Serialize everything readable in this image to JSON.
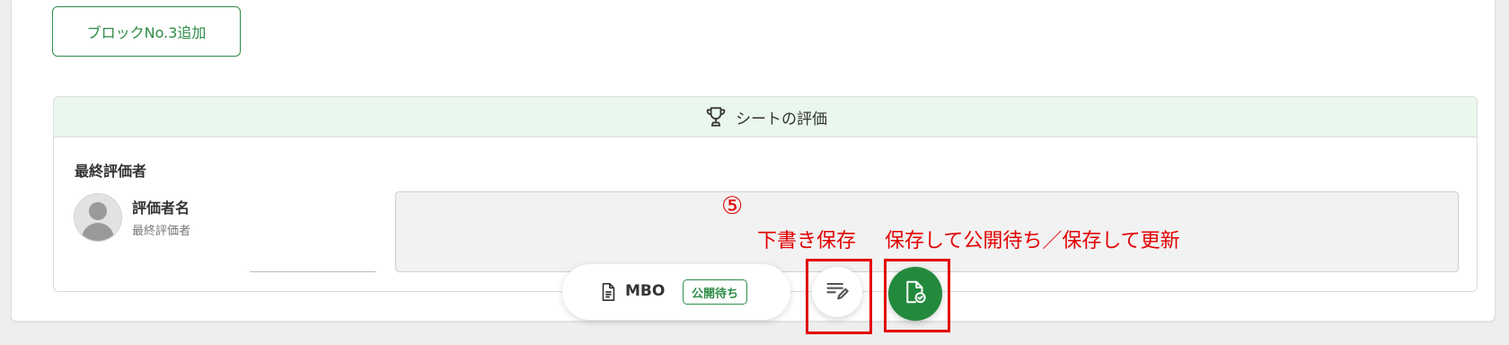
{
  "actions": {
    "add_block_label": "ブロックNo.3追加"
  },
  "evaluation": {
    "title": "シートの評価",
    "final_evaluator_label": "最終評価者",
    "evaluator_name": "評価者名",
    "evaluator_role": "最終評価者"
  },
  "annotations": {
    "step_number": "⑤",
    "draft_label": "下書き保存",
    "publish_label": "保存して公開待ち／保存して更新"
  },
  "footer": {
    "sheet_type": "MBO",
    "status": "公開待ち"
  },
  "icons": {
    "trophy": "trophy-icon",
    "document": "document-icon",
    "draft": "edit-note-icon",
    "publish": "file-check-icon"
  },
  "colors": {
    "accent": "#2e8b47",
    "publish": "#23893c",
    "annotation": "#e30000",
    "header_bg": "#e9f7ec"
  }
}
